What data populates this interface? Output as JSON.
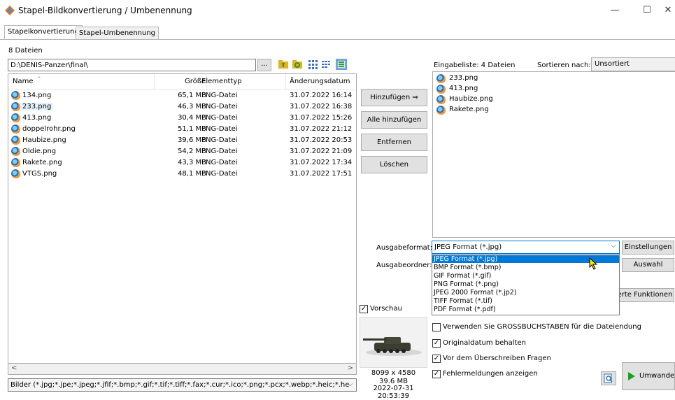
{
  "window": {
    "title": "Stapel-Bildkonvertierung / Umbenennung",
    "minimize": "—",
    "maximize": "☐",
    "close": "✕"
  },
  "tabs": [
    {
      "label": "Stapelkonvertierung",
      "active": true
    },
    {
      "label": "Stapel-Umbenennung",
      "active": false
    }
  ],
  "file_count": "8 Dateien",
  "path": "D:\\DENIS-Panzer\\final\\",
  "browse_label": "...",
  "columns": {
    "name": "Name",
    "size": "Größe",
    "type": "Elementtyp",
    "date": "Änderungsdatum"
  },
  "files": [
    {
      "name": "134.png",
      "size": "65,1 MB",
      "type": "PNG-Datei",
      "date": "31.07.2022 16:14"
    },
    {
      "name": "233.png",
      "size": "46,3 MB",
      "type": "PNG-Datei",
      "date": "31.07.2022 16:38",
      "selected": true
    },
    {
      "name": "413.png",
      "size": "30,4 MB",
      "type": "PNG-Datei",
      "date": "31.07.2022 15:26"
    },
    {
      "name": "doppelrohr.png",
      "size": "51,1 MB",
      "type": "PNG-Datei",
      "date": "31.07.2022 21:12"
    },
    {
      "name": "Haubize.png",
      "size": "39,6 MB",
      "type": "PNG-Datei",
      "date": "31.07.2022 20:53"
    },
    {
      "name": "Oldie.png",
      "size": "54,2 MB",
      "type": "PNG-Datei",
      "date": "31.07.2022 21:09"
    },
    {
      "name": "Rakete.png",
      "size": "43,3 MB",
      "type": "PNG-Datei",
      "date": "31.07.2022 17:34"
    },
    {
      "name": "VTGS.png",
      "size": "48,1 MB",
      "type": "PNG-Datei",
      "date": "31.07.2022 17:51"
    }
  ],
  "filter": "Bilder (*.jpg;*.jpe;*.jpeg;*.jfif;*.bmp;*.gif;*.tif;*.tiff;*.fax;*.cur;*.ico;*.png;*.pcx;*.webp;*.heic;*.he",
  "buttons": {
    "add": "Hinzufügen ⇒",
    "add_all": "Alle hinzufügen",
    "remove": "Entfernen",
    "delete": "Löschen",
    "settings": "Einstellungen",
    "choose": "Auswahl",
    "advanced": "erte Funktionen",
    "convert": "Umwandeln"
  },
  "input_list": {
    "label": "Eingabeliste:  4 Dateien",
    "sort_label": "Sortieren nach:",
    "sort_value": "Unsortiert",
    "items": [
      "233.png",
      "413.png",
      "Haubize.png",
      "Rakete.png"
    ]
  },
  "output": {
    "format_label": "Ausgabeformat:",
    "folder_label": "Ausgabeordner:",
    "format_value": "JPEG Format (*.jpg)",
    "options": [
      "JPEG Format (*.jpg)",
      "BMP Format (*.bmp)",
      "GIF Format (*.gif)",
      "PNG Format (*.png)",
      "JPEG 2000 Format (*.jp2)",
      "TIFF Format (*.tif)",
      "PDF Format (*.pdf)"
    ]
  },
  "checkboxes": {
    "preview": {
      "label": "Vorschau",
      "checked": true
    },
    "uppercase": {
      "label": "Verwenden Sie GROSSBUCHSTABEN für die Dateiendung",
      "checked": false
    },
    "keep_date": {
      "label": "Originaldatum behalten",
      "checked": true
    },
    "ask_overwrite": {
      "label": "Vor dem Überschreiben Fragen",
      "checked": true
    },
    "show_errors": {
      "label": "Fehlermeldungen anzeigen",
      "checked": true
    }
  },
  "preview_info": {
    "dims": "8099 x 4580",
    "size": "39.6 MB",
    "date": "2022-07-31 20:53:39"
  },
  "icons": [
    "app-icon",
    "folder-up-icon",
    "refresh-folder-icon",
    "view-grid-icon",
    "view-list-icon",
    "view-details-icon",
    "sort-asc-icon",
    "chevron-down-icon",
    "cursor-icon",
    "search-preview-icon",
    "play-icon"
  ],
  "colors": {
    "accent": "#0078d7",
    "selected_row": "#e5f3ff",
    "play": "#1aa31a"
  }
}
